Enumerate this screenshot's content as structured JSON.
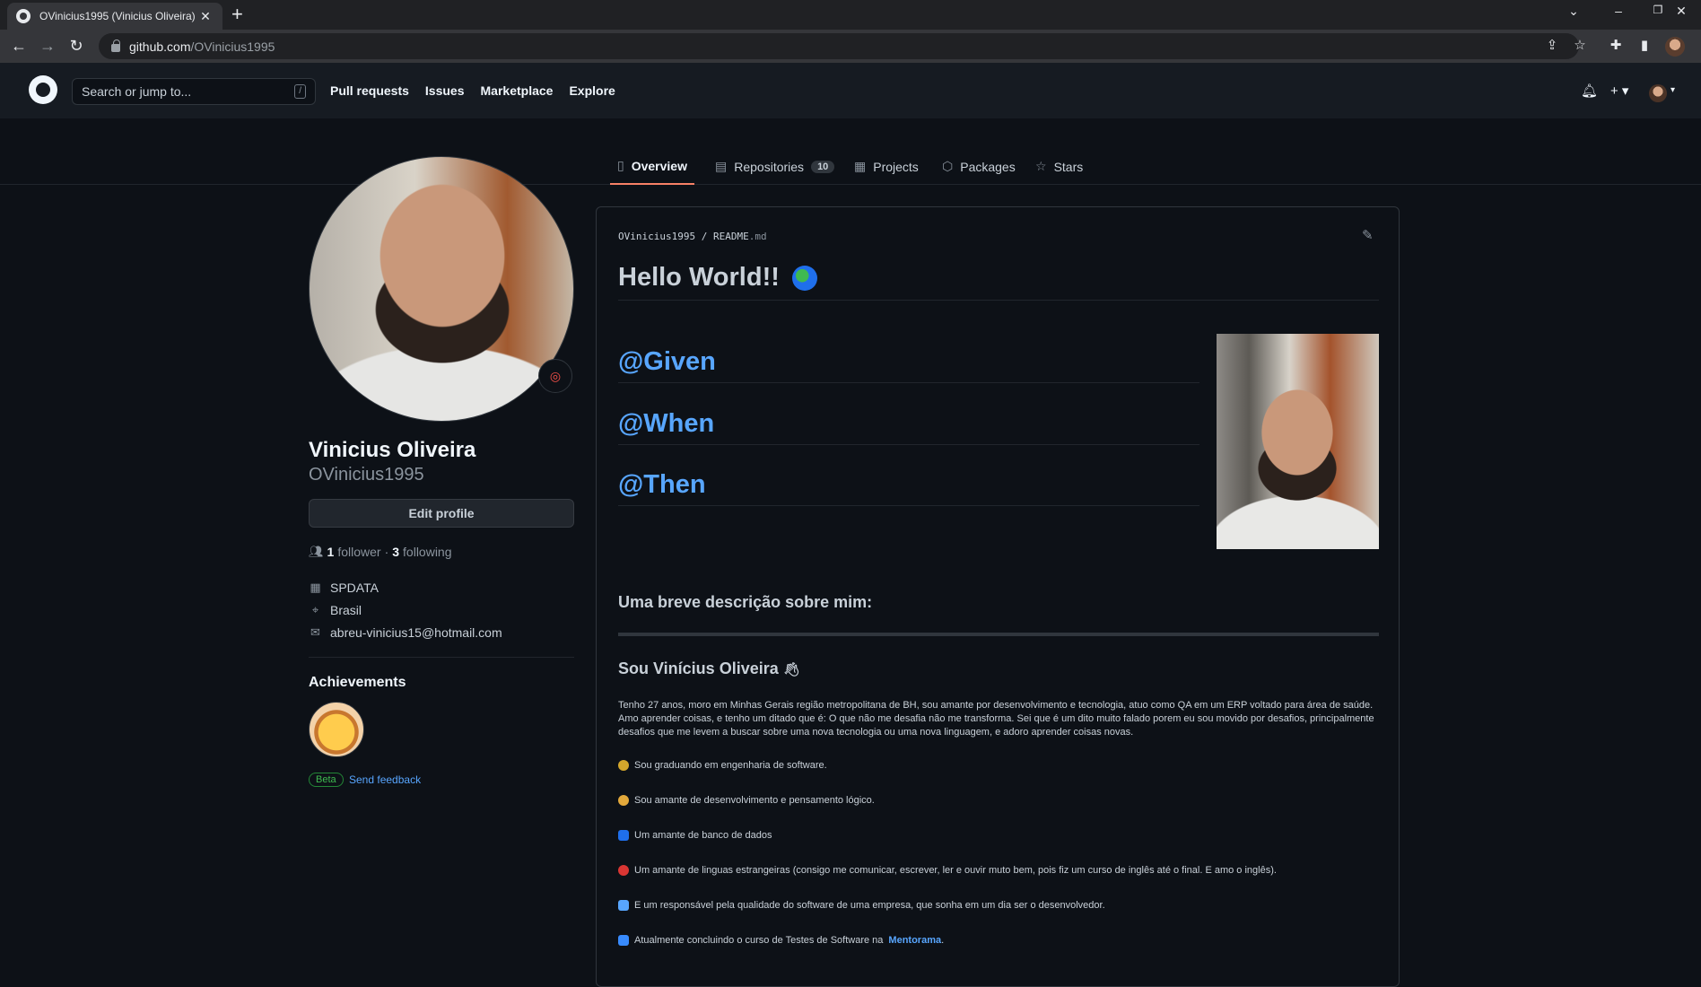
{
  "browser": {
    "tab_title": "OVinicius1995 (Vinicius Oliveira)",
    "tab_close": "✕",
    "new_tab": "+",
    "url_host": "github.com",
    "url_path": "/OVinicius1995"
  },
  "header": {
    "search_placeholder": "Search or jump to...",
    "search_shortcut": "/",
    "nav": [
      "Pull requests",
      "Issues",
      "Marketplace",
      "Explore"
    ],
    "plus": "+ ▾"
  },
  "tabs": {
    "overview": "Overview",
    "repositories": "Repositories",
    "repositories_count": "10",
    "projects": "Projects",
    "packages": "Packages",
    "stars": "Stars"
  },
  "profile": {
    "name": "Vinicius Oliveira",
    "login": "OVinicius1995",
    "edit_button": "Edit profile",
    "followers_count": "1",
    "followers_label": "follower",
    "separator": "·",
    "following_count": "3",
    "following_label": "following",
    "company": "SPDATA",
    "location": "Brasil",
    "email": "abreu-vinicius15@hotmail.com",
    "achievements_title": "Achievements",
    "beta_label": "Beta",
    "feedback_label": "Send feedback"
  },
  "readme": {
    "owner": "OVinicius1995",
    "slash": "/",
    "file": "README",
    "ext": ".md",
    "title": "Hello World!!",
    "given": "@Given",
    "when": "@When",
    "then": "@Then",
    "subtitle": "Uma breve descrição sobre mim:",
    "intro_heading": "Sou Vinícius Oliveira",
    "paragraph": "Tenho 27 anos, moro em Minhas Gerais região metropolitana de BH, sou amante por desenvolvimento e tecnologia, atuo como QA em um ERP voltado para área de saúde. Amo aprender coisas, e tenho um ditado que é: O que não me desafia não me transforma. Sei que é um dito muito falado porem eu sou movido por desafios, principalmente desafios que me levem a buscar sobre uma nova tecnologia ou uma nova linguagem, e adoro aprender coisas novas.",
    "items": [
      "Sou graduando em engenharia de software.",
      "Sou amante de desenvolvimento e pensamento lógico.",
      "Um amante de banco de dados",
      "Um amante de linguas estrangeiras (consigo me comunicar, escrever, ler e ouvir muto bem, pois fiz um curso de inglês até o final. E amo o inglês).",
      "E um responsável pela qualidade do software de uma empresa, que sonha em um dia ser o desenvolvedor.",
      "Atualmente concluindo o curso de Testes de Software na"
    ],
    "link_text": "Mentorama",
    "link_suffix": "."
  },
  "colors": {
    "background": "#0d1117",
    "header": "#161b22",
    "link": "#58a6ff",
    "tab_underline": "#f78166",
    "beta_green": "#3fb950"
  }
}
